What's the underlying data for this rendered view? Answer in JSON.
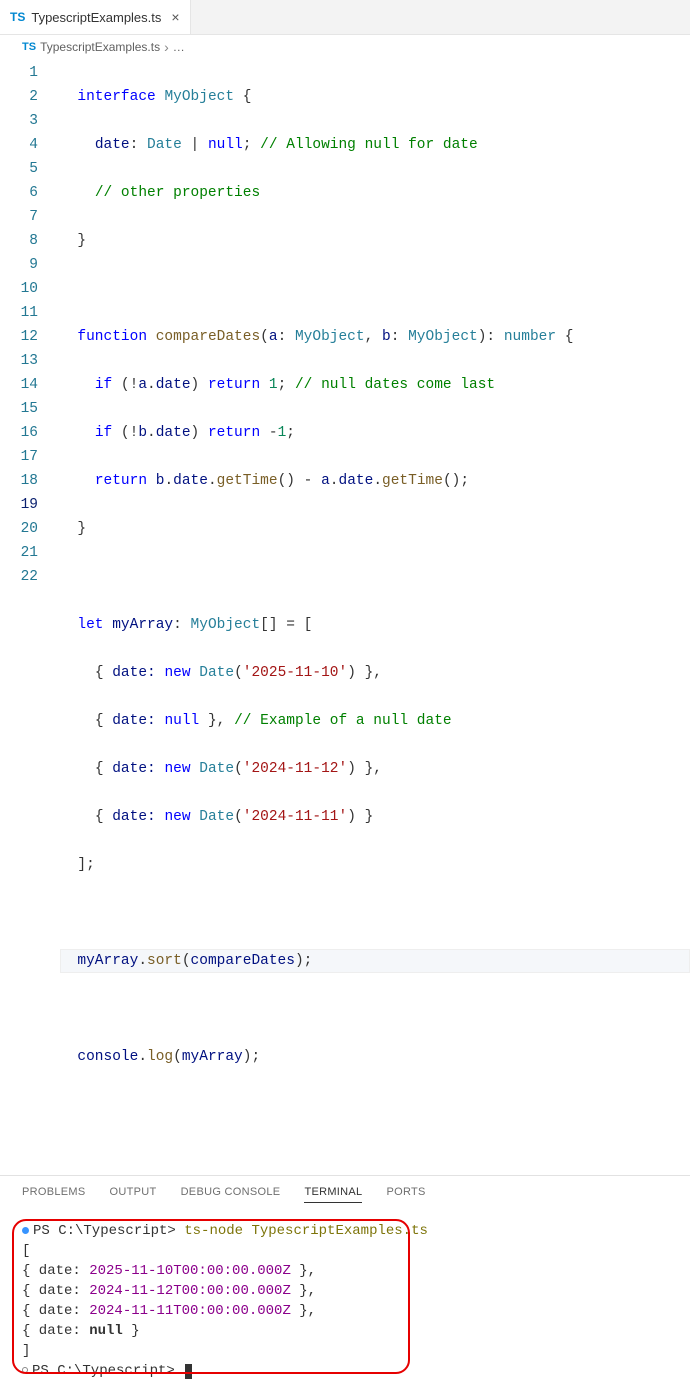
{
  "tab": {
    "icon": "TS",
    "name": "TypescriptExamples.ts"
  },
  "breadcrumb": {
    "icon": "TS",
    "file": "TypescriptExamples.ts",
    "more": "…"
  },
  "lines": [
    1,
    2,
    3,
    4,
    5,
    6,
    7,
    8,
    9,
    10,
    11,
    12,
    13,
    14,
    15,
    16,
    17,
    18,
    19,
    20,
    21,
    22
  ],
  "currentLine": 19,
  "code": {
    "l1": {
      "a": "interface",
      "b": "MyObject",
      "c": " {"
    },
    "l2": {
      "a": "date",
      "b": ": ",
      "c": "Date",
      "d": " | ",
      "e": "null",
      "f": "; ",
      "g": "// Allowing null for date"
    },
    "l3": {
      "a": "// other properties"
    },
    "l4": {
      "a": "}"
    },
    "l6": {
      "a": "function",
      "b": "compareDates",
      "c": "(",
      "d": "a",
      "e": ": ",
      "f": "MyObject",
      "g": ", ",
      "h": "b",
      "i": ": ",
      "j": "MyObject",
      "k": "): ",
      "l": "number",
      "m": " {"
    },
    "l7": {
      "a": "if",
      "b": " (!",
      "c": "a",
      "d": ".",
      "e": "date",
      "f": ") ",
      "g": "return",
      "h": " ",
      "i": "1",
      "j": "; ",
      "k": "// null dates come last"
    },
    "l8": {
      "a": "if",
      "b": " (!",
      "c": "b",
      "d": ".",
      "e": "date",
      "f": ") ",
      "g": "return",
      "h": " -",
      "i": "1",
      "j": ";"
    },
    "l9": {
      "a": "return",
      "b": " ",
      "c": "b",
      "d": ".",
      "e": "date",
      "f": ".",
      "g": "getTime",
      "h": "() - ",
      "i": "a",
      "j": ".",
      "k": "date",
      "l": ".",
      "m": "getTime",
      "n": "();"
    },
    "l10": {
      "a": "}"
    },
    "l12": {
      "a": "let",
      "b": " ",
      "c": "myArray",
      "d": ": ",
      "e": "MyObject",
      "f": "[] = ["
    },
    "l13": {
      "a": "{ ",
      "b": "date:",
      "c": " ",
      "d": "new",
      "e": " ",
      "f": "Date",
      "g": "(",
      "h": "'2025-11-10'",
      "i": ") },"
    },
    "l14": {
      "a": "{ ",
      "b": "date:",
      "c": " ",
      "d": "null",
      "e": " }, ",
      "f": "// Example of a null date"
    },
    "l15": {
      "a": "{ ",
      "b": "date:",
      "c": " ",
      "d": "new",
      "e": " ",
      "f": "Date",
      "g": "(",
      "h": "'2024-11-12'",
      "i": ") },"
    },
    "l16": {
      "a": "{ ",
      "b": "date:",
      "c": " ",
      "d": "new",
      "e": " ",
      "f": "Date",
      "g": "(",
      "h": "'2024-11-11'",
      "i": ") }"
    },
    "l17": {
      "a": "];"
    },
    "l19": {
      "a": "myArray",
      "b": ".",
      "c": "sort",
      "d": "(",
      "e": "compareDates",
      "f": ");"
    },
    "l21": {
      "a": "console",
      "b": ".",
      "c": "log",
      "d": "(",
      "e": "myArray",
      "f": ");"
    }
  },
  "panelTabs": {
    "problems": "PROBLEMS",
    "output": "OUTPUT",
    "debug": "DEBUG CONSOLE",
    "terminal": "TERMINAL",
    "ports": "PORTS"
  },
  "terminal": {
    "prompt1": "PS C:\\Typescript> ",
    "cmd": "ts-node TypescriptExamples.ts",
    "out_open": "[",
    "out1_a": "  { date: ",
    "out1_b": "2025-11-10T00:00:00.000Z",
    "out1_c": " },",
    "out2_a": "  { date: ",
    "out2_b": "2024-11-12T00:00:00.000Z",
    "out2_c": " },",
    "out3_a": "  { date: ",
    "out3_b": "2024-11-11T00:00:00.000Z",
    "out3_c": " },",
    "out4_a": "  { date: ",
    "out4_b": "null",
    "out4_c": " }",
    "out_close": "]",
    "prompt2": "PS C:\\Typescript> "
  }
}
